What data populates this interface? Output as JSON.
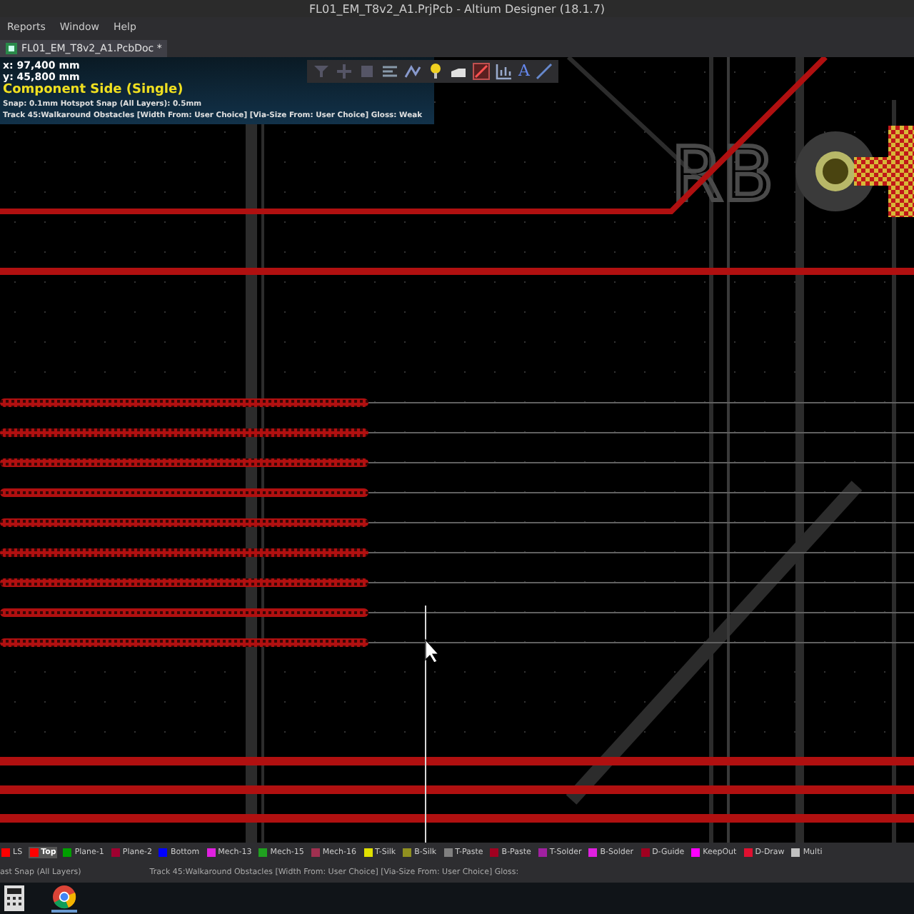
{
  "window": {
    "title": "FL01_EM_T8v2_A1.PrjPcb - Altium Designer (18.1.7)"
  },
  "menu": [
    "Reports",
    "Window",
    "Help"
  ],
  "tabs": [
    {
      "label": "FL01_EM_T8v2_A1.PcbDoc *",
      "selected": true
    }
  ],
  "overlay": {
    "x": "x: 97,400 mm",
    "y": "y: 45,800 mm",
    "side": "Component Side (Single)",
    "snap": "Snap: 0.1mm Hotspot Snap (All Layers): 0.5mm",
    "mode": "Track 45:Walkaround Obstacles [Width From: User Choice]  [Via-Size From: User Choice] Gloss: Weak"
  },
  "toolbar_text_tool": "A",
  "silkscreen_text": "RB",
  "layers": [
    {
      "label": "LS",
      "color": "#ff0000",
      "selected": false
    },
    {
      "label": "Top",
      "color": "#ff0000",
      "selected": true
    },
    {
      "label": "Plane-1",
      "color": "#00a000",
      "selected": false
    },
    {
      "label": "Plane-2",
      "color": "#a00030",
      "selected": false
    },
    {
      "label": "Bottom",
      "color": "#0000ff",
      "selected": false
    },
    {
      "label": "Mech-13",
      "color": "#e020e0",
      "selected": false
    },
    {
      "label": "Mech-15",
      "color": "#20a020",
      "selected": false
    },
    {
      "label": "Mech-16",
      "color": "#a03050",
      "selected": false
    },
    {
      "label": "T-Silk",
      "color": "#e0e000",
      "selected": false
    },
    {
      "label": "B-Silk",
      "color": "#909020",
      "selected": false
    },
    {
      "label": "T-Paste",
      "color": "#808080",
      "selected": false
    },
    {
      "label": "B-Paste",
      "color": "#a00020",
      "selected": false
    },
    {
      "label": "T-Solder",
      "color": "#a020a0",
      "selected": false
    },
    {
      "label": "B-Solder",
      "color": "#e020e0",
      "selected": false
    },
    {
      "label": "D-Guide",
      "color": "#a00020",
      "selected": false
    },
    {
      "label": "KeepOut",
      "color": "#ff00ff",
      "selected": false
    },
    {
      "label": "D-Draw",
      "color": "#e01030",
      "selected": false
    },
    {
      "label": "Multi",
      "color": "#c0c0c0",
      "selected": false
    }
  ],
  "status_bar": {
    "left": "ast Snap (All Layers)",
    "right": "Track 45:Walkaround Obstacles [Width From: User Choice]  [Via-Size From: User Choice]  Gloss:"
  }
}
